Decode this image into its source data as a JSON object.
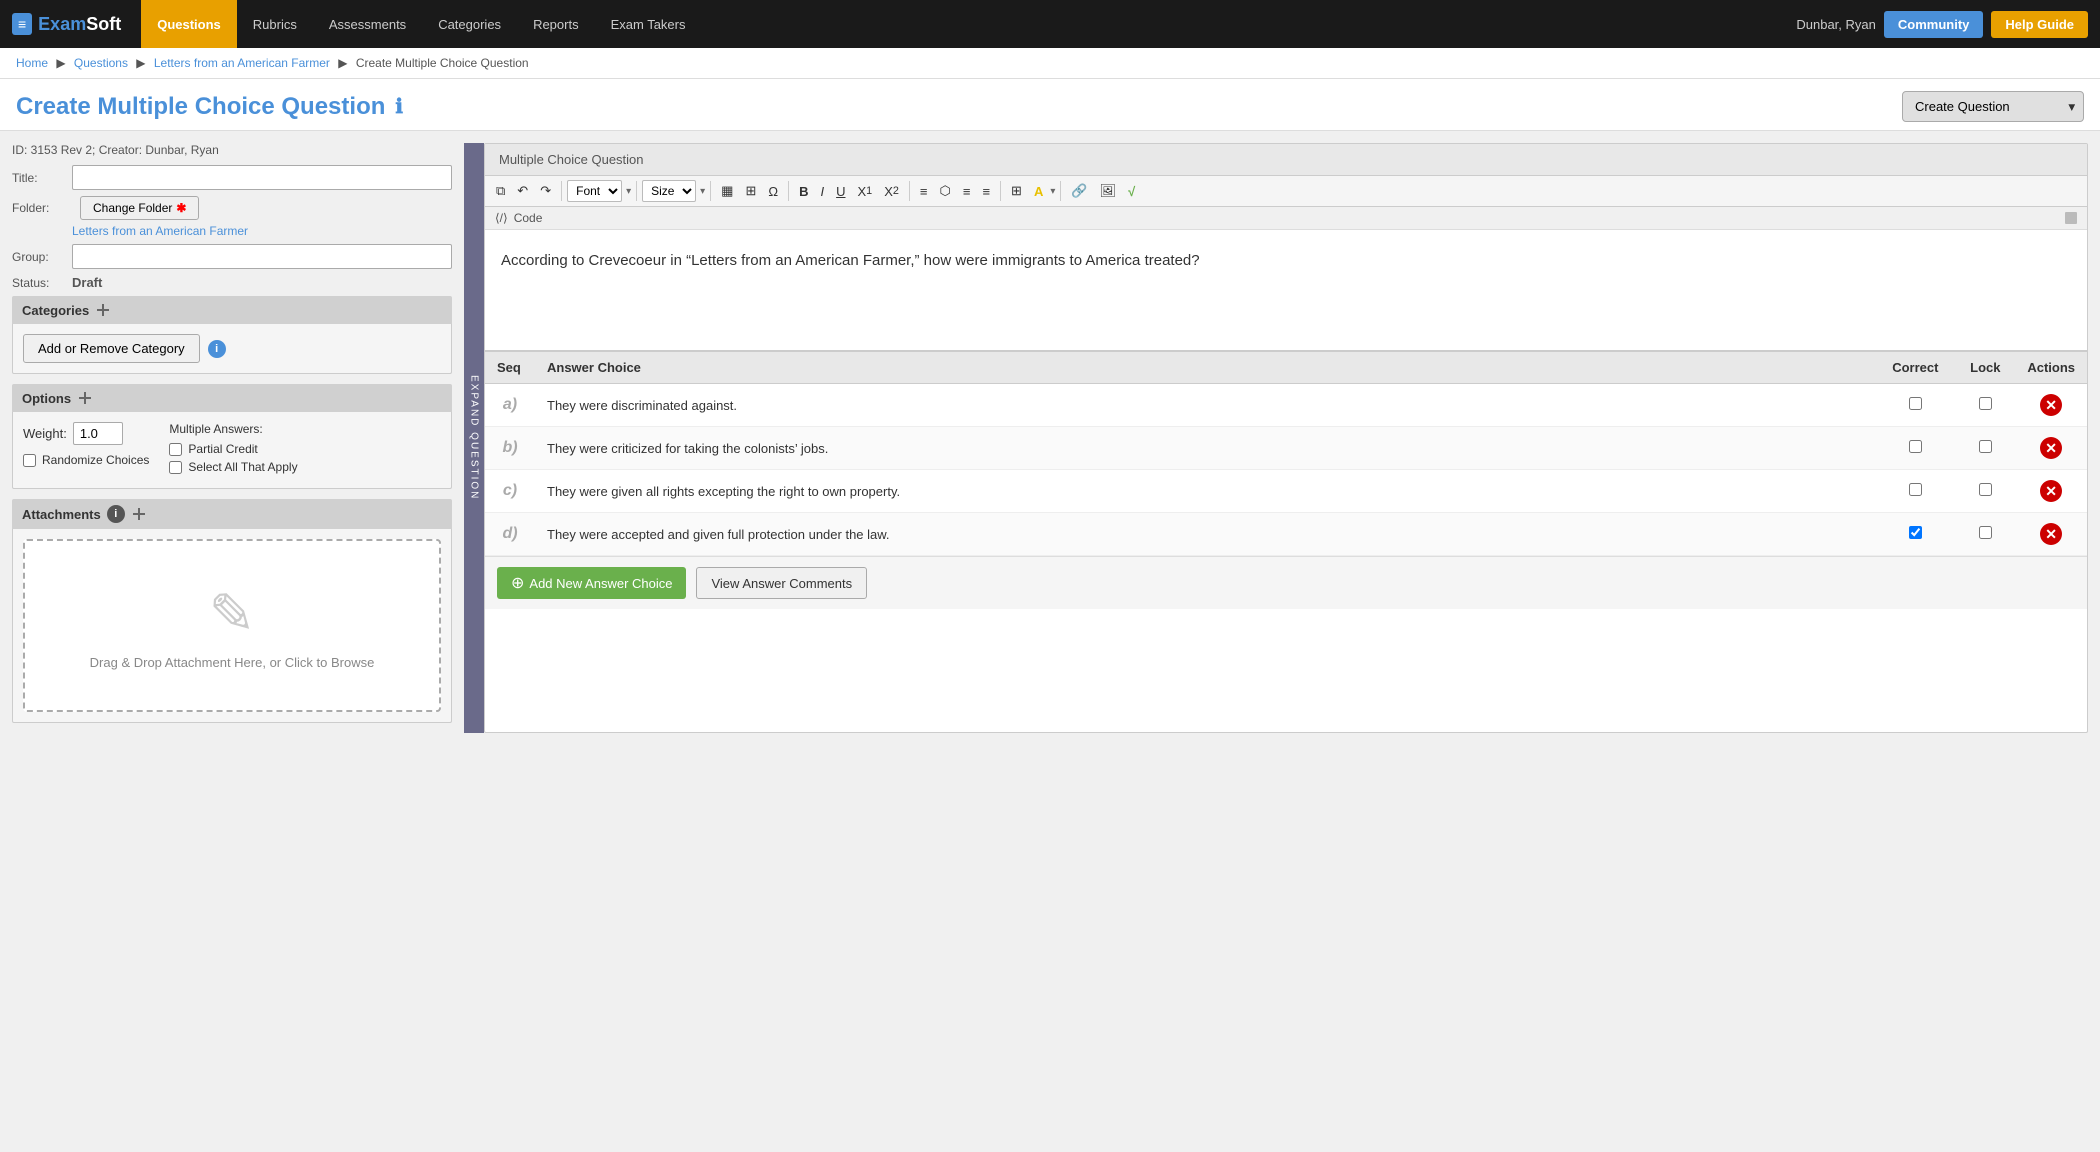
{
  "nav": {
    "logo_icon": "≡",
    "logo_text_exam": "Exam",
    "logo_text_soft": "Soft",
    "items": [
      {
        "label": "Questions",
        "active": true
      },
      {
        "label": "Rubrics",
        "active": false
      },
      {
        "label": "Assessments",
        "active": false
      },
      {
        "label": "Categories",
        "active": false
      },
      {
        "label": "Reports",
        "active": false
      },
      {
        "label": "Exam Takers",
        "active": false
      }
    ],
    "user": "Dunbar, Ryan",
    "community_btn": "Community",
    "help_btn": "Help Guide"
  },
  "breadcrumb": {
    "items": [
      "Home",
      "Questions",
      "Letters from an American Farmer"
    ],
    "current": "Create Multiple Choice Question"
  },
  "page": {
    "title": "Create Multiple Choice Question",
    "info_icon": "ℹ",
    "create_question_label": "Create Question"
  },
  "meta": {
    "id_creator": "ID: 3153 Rev 2; Creator: Dunbar, Ryan",
    "title_label": "Title:",
    "title_value": "",
    "folder_label": "Folder:",
    "change_folder_btn": "Change Folder",
    "folder_link": "Letters from an American Farmer",
    "group_label": "Group:",
    "group_value": "",
    "status_label": "Status:",
    "status_value": "Draft"
  },
  "categories": {
    "section_title": "Categories",
    "add_remove_btn": "Add or Remove Category"
  },
  "options": {
    "section_title": "Options",
    "weight_label": "Weight:",
    "weight_value": "1.0",
    "randomize_label": "Randomize Choices",
    "multiple_answers_label": "Multiple Answers:",
    "partial_credit_label": "Partial Credit",
    "select_all_label": "Select All That Apply"
  },
  "attachments": {
    "section_title": "Attachments",
    "drop_text": "Drag & Drop Attachment Here, or Click to Browse"
  },
  "editor": {
    "label": "Multiple Choice Question",
    "toolbar": {
      "font_label": "Font",
      "size_label": "Size"
    },
    "code_label": "Code",
    "question_text": "According to Crevecoeur in “Letters from an American Farmer,” how were immigrants to America treated?"
  },
  "answers": {
    "col_seq": "Seq",
    "col_answer": "Answer Choice",
    "col_correct": "Correct",
    "col_lock": "Lock",
    "col_actions": "Actions",
    "rows": [
      {
        "seq": "a)",
        "text": "They were discriminated against.",
        "correct": false,
        "lock": false
      },
      {
        "seq": "b)",
        "text": "They were criticized for taking the colonists’ jobs.",
        "correct": false,
        "lock": false
      },
      {
        "seq": "c)",
        "text": "They were given all rights excepting the right to own property.",
        "correct": false,
        "lock": false
      },
      {
        "seq": "d)",
        "text": "They were accepted and given full protection under the law.",
        "correct": true,
        "lock": false
      }
    ],
    "add_answer_btn": "Add New Answer Choice",
    "view_comments_btn": "View Answer Comments"
  },
  "expand_text": "E X P A N D   Q U E S T I O N"
}
